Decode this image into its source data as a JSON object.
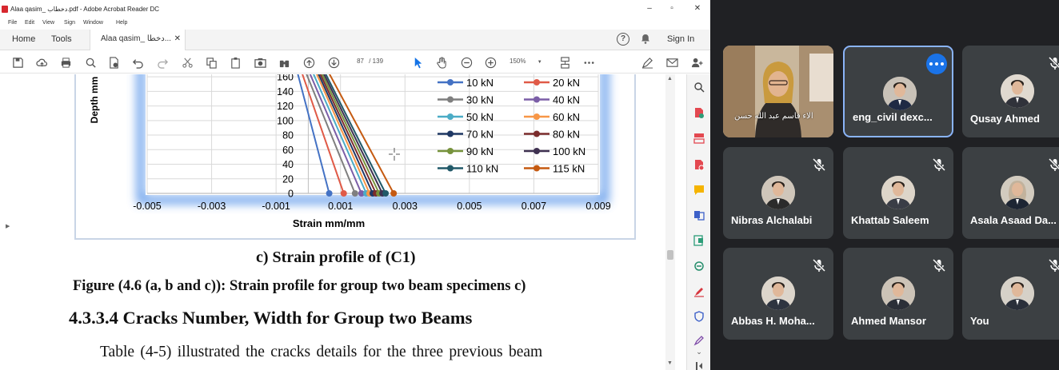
{
  "acrobat": {
    "window_title": "Alaa qasim_ دخطاب.pdf - Adobe Acrobat Reader DC",
    "menu": [
      "File",
      "Edit",
      "View",
      "Sign",
      "Window",
      "Help"
    ],
    "tabs": {
      "home": "Home",
      "tools": "Tools",
      "document": "Alaa qasim_ دخطا..."
    },
    "sign_in": "Sign In",
    "page_current": "87",
    "page_total": "/ 139",
    "zoom": "150%"
  },
  "document": {
    "caption": "c) Strain profile of (C1)",
    "figure_title": "Figure (4.6 (a, b and c)): Strain profile for group two beam specimens c)",
    "section_heading": "4.3.3.4 Cracks Number, Width for Group two Beams",
    "body_text": "Table (4-5) illustrated the cracks details for the three previous beam"
  },
  "chart_data": {
    "type": "line",
    "xlabel": "Strain mm/mm",
    "ylabel": "Depth mm",
    "xlim": [
      -0.005,
      0.009
    ],
    "ylim": [
      0,
      170
    ],
    "x_ticks": [
      "-0.005",
      "-0.003",
      "-0.001",
      "0.001",
      "0.003",
      "0.005",
      "0.007",
      "0.009"
    ],
    "y_ticks": [
      "0",
      "20",
      "40",
      "60",
      "80",
      "100",
      "120",
      "140",
      "160"
    ],
    "grid": true,
    "legend_position": "right, inside plot",
    "series": [
      {
        "name": "10 kN",
        "color": "#4472c4",
        "points": [
          [
            0.00065,
            0
          ],
          [
            -0.00045,
            185
          ]
        ]
      },
      {
        "name": "20 kN",
        "color": "#e05a47",
        "points": [
          [
            0.0011,
            0
          ],
          [
            -0.00035,
            185
          ]
        ]
      },
      {
        "name": "30 kN",
        "color": "#7f7f7f",
        "points": [
          [
            0.00145,
            0
          ],
          [
            -0.00025,
            185
          ]
        ]
      },
      {
        "name": "40 kN",
        "color": "#7b5ea7",
        "points": [
          [
            0.00165,
            0
          ],
          [
            -0.00015,
            185
          ]
        ]
      },
      {
        "name": "50 kN",
        "color": "#4bacc6",
        "points": [
          [
            0.0018,
            0
          ],
          [
            -5e-05,
            185
          ]
        ]
      },
      {
        "name": "60 kN",
        "color": "#f79646",
        "points": [
          [
            0.0019,
            0
          ],
          [
            5e-05,
            185
          ]
        ]
      },
      {
        "name": "70 kN",
        "color": "#1f3864",
        "points": [
          [
            0.002,
            0
          ],
          [
            0.0001,
            185
          ]
        ]
      },
      {
        "name": "80 kN",
        "color": "#7b2c2c",
        "points": [
          [
            0.0021,
            0
          ],
          [
            0.00015,
            185
          ]
        ]
      },
      {
        "name": "90 kN",
        "color": "#77933c",
        "points": [
          [
            0.0022,
            0
          ],
          [
            0.0002,
            185
          ]
        ]
      },
      {
        "name": "100 kN",
        "color": "#3f3151",
        "points": [
          [
            0.0023,
            0
          ],
          [
            0.00025,
            185
          ]
        ]
      },
      {
        "name": "110 kN",
        "color": "#215968",
        "points": [
          [
            0.0024,
            0
          ],
          [
            0.0003,
            185
          ]
        ]
      },
      {
        "name": "115 kN",
        "color": "#c55a11",
        "points": [
          [
            0.00265,
            0
          ],
          [
            0.0004,
            185
          ]
        ]
      }
    ]
  },
  "meet": {
    "tiles": [
      {
        "name": "الاء قاسم عبد الله حسن",
        "video": true,
        "muted": false
      },
      {
        "name": "eng_civil dexc...",
        "video": false,
        "muted": false,
        "speaking": true,
        "menu": true
      },
      {
        "name": "Qusay Ahmed",
        "video": false,
        "muted": true
      },
      {
        "name": "Nibras Alchalabi",
        "video": false,
        "muted": true
      },
      {
        "name": "Khattab Saleem",
        "video": false,
        "muted": true
      },
      {
        "name": "Asala Asaad Da...",
        "video": false,
        "muted": true
      },
      {
        "name": "Abbas H. Moha...",
        "video": false,
        "muted": true
      },
      {
        "name": "Ahmed Mansor",
        "video": false,
        "muted": true
      },
      {
        "name": "You",
        "video": false,
        "muted": true
      }
    ]
  }
}
